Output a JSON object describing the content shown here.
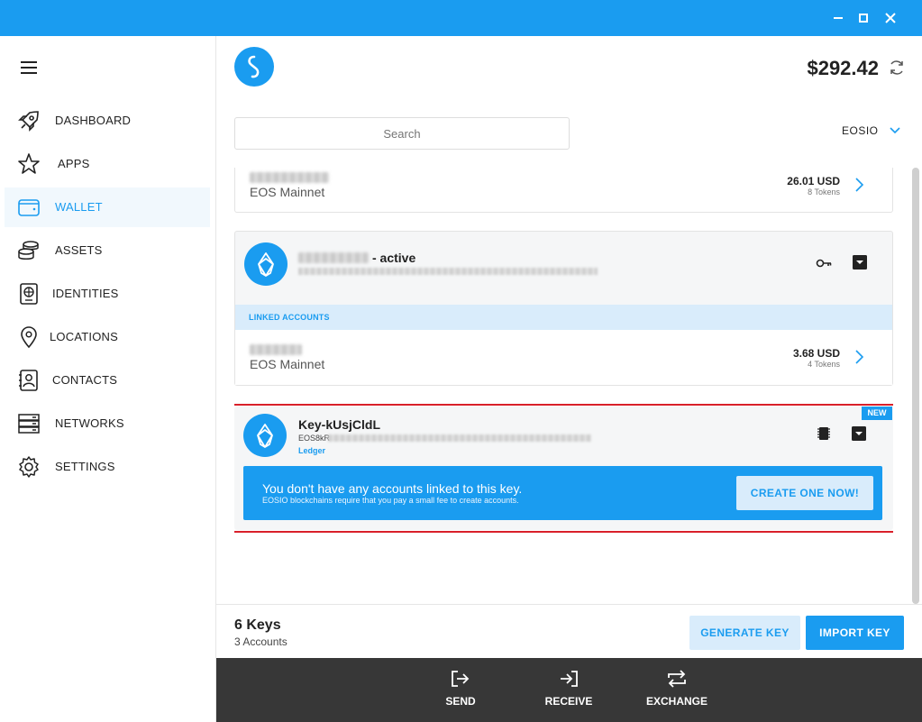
{
  "window": {
    "icons": [
      "minimize-icon",
      "maximize-icon",
      "close-icon"
    ]
  },
  "sidebar": {
    "items": [
      {
        "label": "DASHBOARD",
        "icon": "rocket-icon"
      },
      {
        "label": "APPS",
        "icon": "star-icon"
      },
      {
        "label": "WALLET",
        "icon": "wallet-icon",
        "active": true
      },
      {
        "label": "ASSETS",
        "icon": "coins-icon"
      },
      {
        "label": "IDENTITIES",
        "icon": "passport-icon"
      },
      {
        "label": "LOCATIONS",
        "icon": "location-pin-icon"
      },
      {
        "label": "CONTACTS",
        "icon": "contacts-icon"
      },
      {
        "label": "NETWORKS",
        "icon": "server-icon"
      },
      {
        "label": "SETTINGS",
        "icon": "gear-icon"
      }
    ]
  },
  "header": {
    "balance": "$292.42"
  },
  "search": {
    "placeholder": "Search"
  },
  "chain_filter": {
    "selected": "EOSIO"
  },
  "accounts": {
    "top_row": {
      "network": "EOS Mainnet",
      "amount": "26.01 USD",
      "tokens": "8 Tokens"
    },
    "key1": {
      "suffix": "- active",
      "linked_label": "LINKED ACCOUNTS",
      "linked_row": {
        "network": "EOS Mainnet",
        "amount": "3.68 USD",
        "tokens": "4 Tokens"
      }
    },
    "key2": {
      "title": "Key-kUsjCldL",
      "pubkey_prefix": "EOS8kR",
      "device": "Ledger",
      "badge": "NEW",
      "notice_title": "You don't have any accounts linked to this key.",
      "notice_sub": "EOSIO blockchains require that you pay a small fee to create accounts.",
      "create_label": "CREATE ONE NOW!"
    }
  },
  "footer": {
    "keys": "6 Keys",
    "accounts": "3 Accounts",
    "generate_label": "GENERATE KEY",
    "import_label": "IMPORT KEY"
  },
  "actions": [
    {
      "label": "SEND",
      "icon": "send-icon"
    },
    {
      "label": "RECEIVE",
      "icon": "receive-icon"
    },
    {
      "label": "EXCHANGE",
      "icon": "exchange-icon"
    }
  ],
  "colors": {
    "accent": "#1a9cf0",
    "accent_light": "#d9ecfb",
    "highlight": "#d9202a",
    "actionbar": "#373737"
  }
}
